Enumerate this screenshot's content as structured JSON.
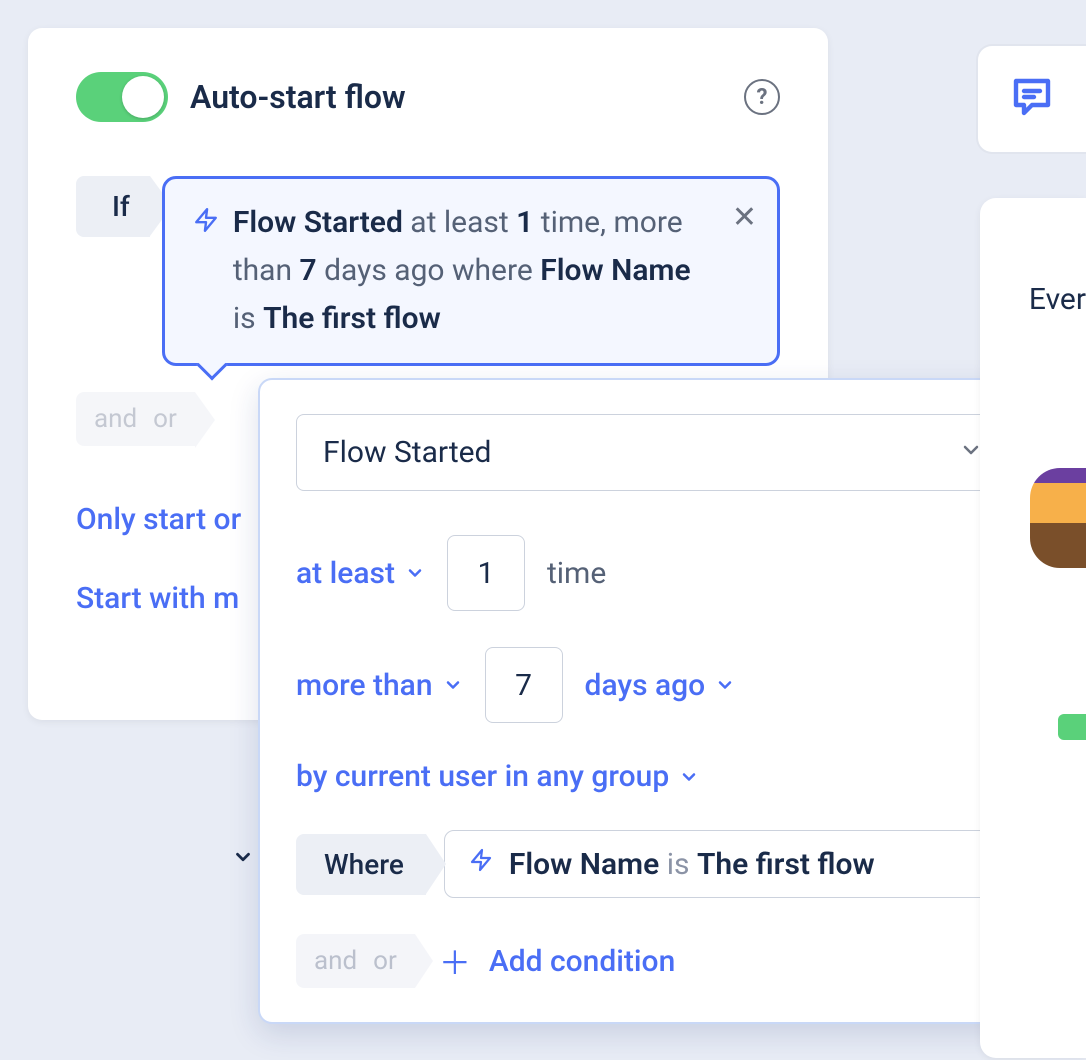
{
  "header": {
    "title": "Auto-start flow"
  },
  "condition": {
    "if_label": "If",
    "event": "Flow Started",
    "at_least_prefix": "at least",
    "count": "1",
    "time_word": "time,",
    "more_than_prefix": "more than",
    "days": "7",
    "days_suffix": "days ago",
    "where_prefix": "where",
    "field": "Flow Name",
    "is_word": "is",
    "value": "The first flow"
  },
  "andor": {
    "and": "and",
    "or": "or"
  },
  "links": {
    "only_start": "Only start or",
    "start_with": "Start with m"
  },
  "popup": {
    "select_value": "Flow Started",
    "at_least": "at least",
    "count": "1",
    "time_word": "time",
    "more_than": "more than",
    "days": "7",
    "days_ago": "days ago",
    "scope": "by current user in any group",
    "where_label": "Where",
    "field": "Flow Name",
    "is_word": "is",
    "value": "The first flow",
    "add_condition": "Add condition"
  },
  "right": {
    "ever": "Ever"
  }
}
